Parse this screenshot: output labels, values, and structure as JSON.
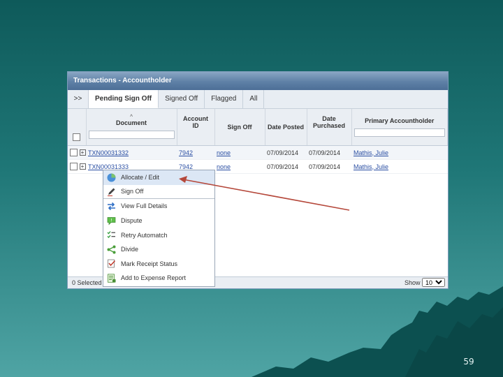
{
  "window": {
    "title": "Transactions - Accountholder"
  },
  "tabs": [
    {
      "label": ">>"
    },
    {
      "label": "Pending Sign Off",
      "active": true
    },
    {
      "label": "Signed Off"
    },
    {
      "label": "Flagged"
    },
    {
      "label": "All"
    }
  ],
  "columns": {
    "document": "Document",
    "account_id": "Account ID",
    "sign_off": "Sign Off",
    "date_posted": "Date Posted",
    "date_purchased": "Date Purchased",
    "primary_accountholder": "Primary Accountholder"
  },
  "rows": [
    {
      "document": "TXN00031332",
      "account_id": "7942",
      "sign_off": "none",
      "date_posted": "07/09/2014",
      "date_purchased": "07/09/2014",
      "accountholder": "Mathis, Julie"
    },
    {
      "document": "TXN00031333",
      "account_id": "7942",
      "sign_off": "none",
      "date_posted": "07/09/2014",
      "date_purchased": "07/09/2014",
      "accountholder": "Mathis, Julie"
    }
  ],
  "context_menu": [
    {
      "label": "Allocate / Edit",
      "icon": "pie-chart-icon"
    },
    {
      "label": "Sign Off",
      "icon": "pen-icon"
    },
    {
      "label": "View Full Details",
      "icon": "swap-arrows-icon"
    },
    {
      "label": "Dispute",
      "icon": "speech-bubble-icon"
    },
    {
      "label": "Retry Automatch",
      "icon": "checklist-icon"
    },
    {
      "label": "Divide",
      "icon": "share-icon"
    },
    {
      "label": "Mark Receipt Status",
      "icon": "receipt-check-icon"
    },
    {
      "label": "Add to Expense Report",
      "icon": "expense-report-icon"
    }
  ],
  "footer": {
    "selected": "0 Selected",
    "show_label": "Show",
    "page_size": "10"
  },
  "slide": {
    "number": "59"
  },
  "colors": {
    "accent": "#2b4fa3",
    "arrow": "#b5483b",
    "menu_highlight": "#dce7f5"
  }
}
